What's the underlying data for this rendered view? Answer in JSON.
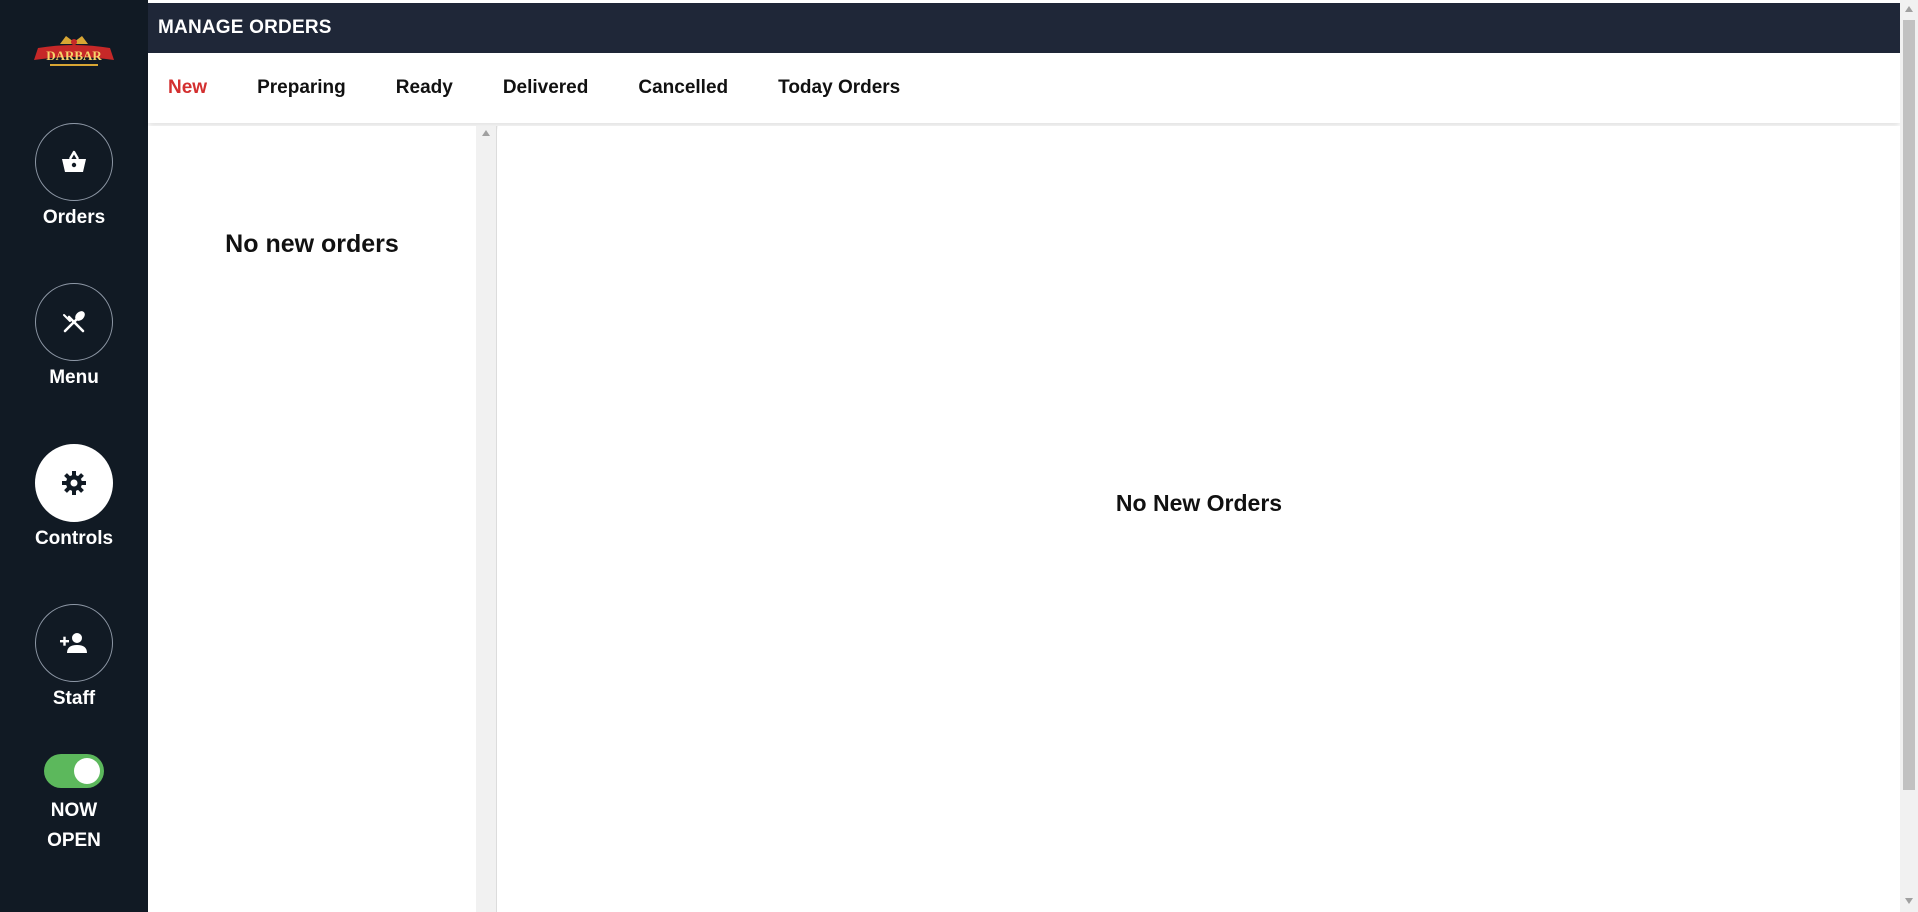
{
  "sidebar": {
    "logo_alt": "DARBAR",
    "items": [
      {
        "label": "Orders",
        "icon": "basket-icon",
        "active": false
      },
      {
        "label": "Menu",
        "icon": "fork-spoon-icon",
        "active": false
      },
      {
        "label": "Controls",
        "icon": "gear-icon",
        "active": true
      },
      {
        "label": "Staff",
        "icon": "add-person-icon",
        "active": false
      }
    ],
    "toggle": {
      "line1": "NOW",
      "line2": "OPEN",
      "on": true
    }
  },
  "header": {
    "title": "MANAGE ORDERS"
  },
  "tabs": [
    {
      "label": "New",
      "active": true
    },
    {
      "label": "Preparing",
      "active": false
    },
    {
      "label": "Ready",
      "active": false
    },
    {
      "label": "Delivered",
      "active": false
    },
    {
      "label": "Cancelled",
      "active": false
    },
    {
      "label": "Today Orders",
      "active": false
    }
  ],
  "left_panel": {
    "empty_text": "No new orders"
  },
  "main_panel": {
    "empty_text": "No New Orders"
  },
  "colors": {
    "sidebar_bg": "#111a24",
    "header_bg": "#1f2738",
    "active_tab": "#d32f2f",
    "toggle_on": "#5cb85c"
  }
}
